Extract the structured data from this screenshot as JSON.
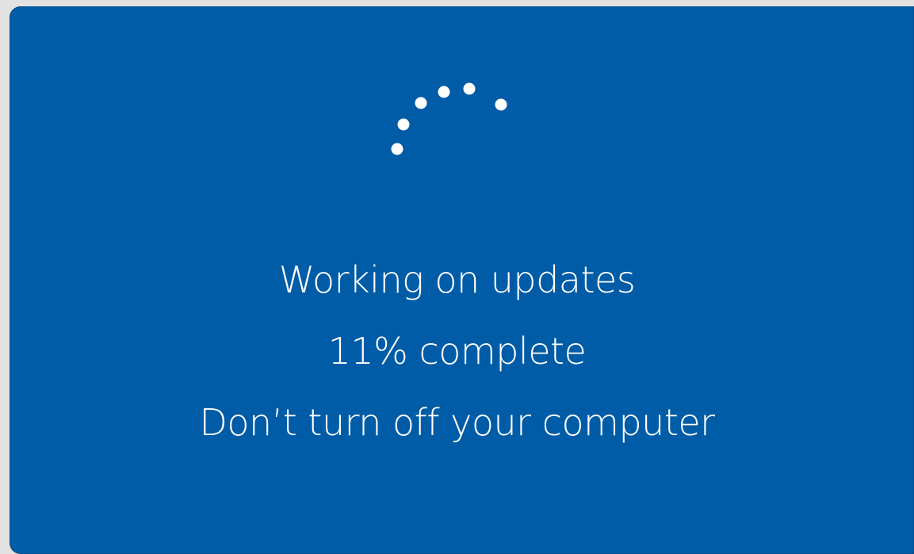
{
  "screen": {
    "background_color": "#005ca6",
    "spinner_icon": "loading-dots-spinner",
    "title": "Working on updates",
    "progress_text": "11% complete",
    "progress_percent": 11,
    "warning": "Don’t turn off your computer"
  }
}
